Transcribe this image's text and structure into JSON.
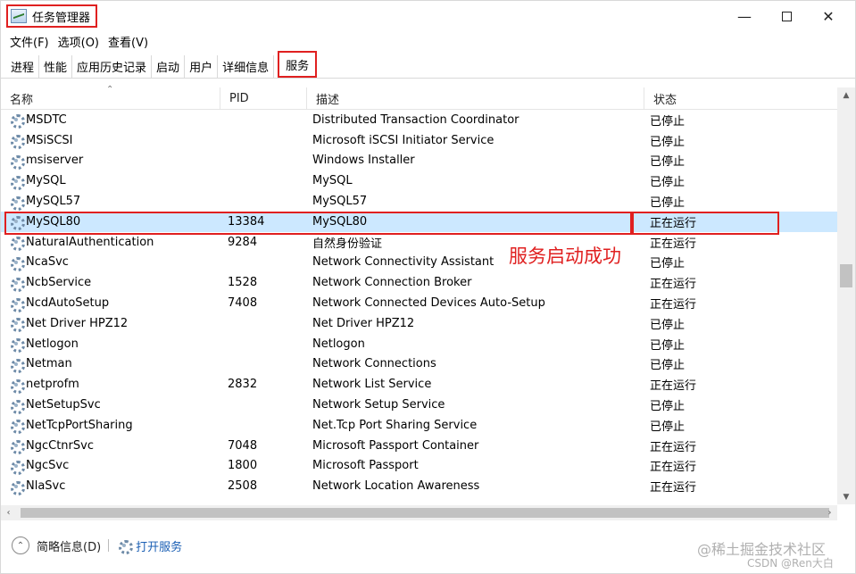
{
  "window": {
    "title": "任务管理器"
  },
  "menu": [
    "文件(F)",
    "选项(O)",
    "查看(V)"
  ],
  "tabs": [
    {
      "label": "进程",
      "active": false
    },
    {
      "label": "性能",
      "active": false
    },
    {
      "label": "应用历史记录",
      "active": false
    },
    {
      "label": "启动",
      "active": false
    },
    {
      "label": "用户",
      "active": false
    },
    {
      "label": "详细信息",
      "active": false
    },
    {
      "label": "服务",
      "active": true
    }
  ],
  "columns": {
    "name": "名称",
    "pid": "PID",
    "desc": "描述",
    "status": "状态"
  },
  "services": [
    {
      "name": "MSDTC",
      "pid": "",
      "desc": "Distributed Transaction Coordinator",
      "status": "已停止"
    },
    {
      "name": "MSiSCSI",
      "pid": "",
      "desc": "Microsoft iSCSI Initiator Service",
      "status": "已停止"
    },
    {
      "name": "msiserver",
      "pid": "",
      "desc": "Windows Installer",
      "status": "已停止"
    },
    {
      "name": "MySQL",
      "pid": "",
      "desc": "MySQL",
      "status": "已停止"
    },
    {
      "name": "MySQL57",
      "pid": "",
      "desc": "MySQL57",
      "status": "已停止"
    },
    {
      "name": "MySQL80",
      "pid": "13384",
      "desc": "MySQL80",
      "status": "正在运行",
      "selected": true
    },
    {
      "name": "NaturalAuthentication",
      "pid": "9284",
      "desc": "自然身份验证",
      "status": "正在运行"
    },
    {
      "name": "NcaSvc",
      "pid": "",
      "desc": "Network Connectivity Assistant",
      "status": "已停止"
    },
    {
      "name": "NcbService",
      "pid": "1528",
      "desc": "Network Connection Broker",
      "status": "正在运行"
    },
    {
      "name": "NcdAutoSetup",
      "pid": "7408",
      "desc": "Network Connected Devices Auto-Setup",
      "status": "正在运行"
    },
    {
      "name": "Net Driver HPZ12",
      "pid": "",
      "desc": "Net Driver HPZ12",
      "status": "已停止"
    },
    {
      "name": "Netlogon",
      "pid": "",
      "desc": "Netlogon",
      "status": "已停止"
    },
    {
      "name": "Netman",
      "pid": "",
      "desc": "Network Connections",
      "status": "已停止"
    },
    {
      "name": "netprofm",
      "pid": "2832",
      "desc": "Network List Service",
      "status": "正在运行"
    },
    {
      "name": "NetSetupSvc",
      "pid": "",
      "desc": "Network Setup Service",
      "status": "已停止"
    },
    {
      "name": "NetTcpPortSharing",
      "pid": "",
      "desc": "Net.Tcp Port Sharing Service",
      "status": "已停止"
    },
    {
      "name": "NgcCtnrSvc",
      "pid": "7048",
      "desc": "Microsoft Passport Container",
      "status": "正在运行"
    },
    {
      "name": "NgcSvc",
      "pid": "1800",
      "desc": "Microsoft Passport",
      "status": "正在运行"
    },
    {
      "name": "NlaSvc",
      "pid": "2508",
      "desc": "Network Location Awareness",
      "status": "正在运行"
    }
  ],
  "annotation": "服务启动成功",
  "footer": {
    "collapse": "简略信息(D)",
    "open_services": "打开服务"
  },
  "watermark": {
    "line1": "@稀土掘金技术社区",
    "line2": "CSDN @Ren大白"
  },
  "colors": {
    "highlight": "#e02020",
    "selected_row": "#cce8ff",
    "link": "#1a5fb4"
  }
}
